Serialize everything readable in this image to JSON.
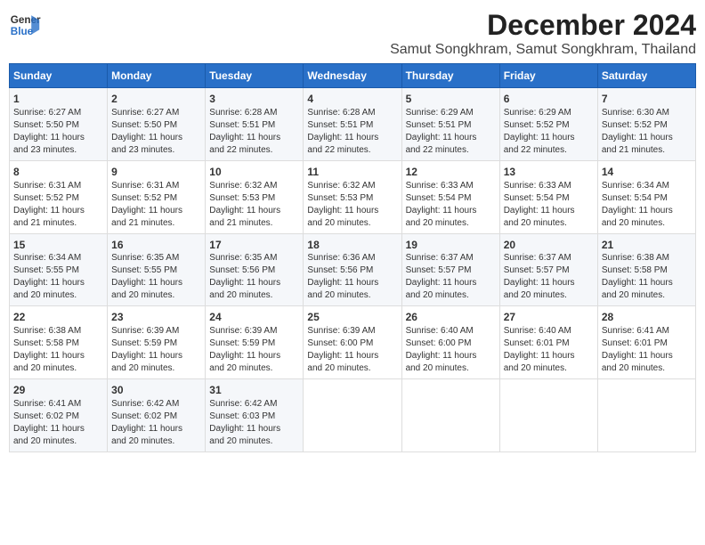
{
  "logo": {
    "line1": "General",
    "line2": "Blue"
  },
  "title": "December 2024",
  "subtitle": "Samut Songkhram, Samut Songkhram, Thailand",
  "days_header": [
    "Sunday",
    "Monday",
    "Tuesday",
    "Wednesday",
    "Thursday",
    "Friday",
    "Saturday"
  ],
  "weeks": [
    [
      {
        "day": "1",
        "info": "Sunrise: 6:27 AM\nSunset: 5:50 PM\nDaylight: 11 hours\nand 23 minutes."
      },
      {
        "day": "2",
        "info": "Sunrise: 6:27 AM\nSunset: 5:50 PM\nDaylight: 11 hours\nand 23 minutes."
      },
      {
        "day": "3",
        "info": "Sunrise: 6:28 AM\nSunset: 5:51 PM\nDaylight: 11 hours\nand 22 minutes."
      },
      {
        "day": "4",
        "info": "Sunrise: 6:28 AM\nSunset: 5:51 PM\nDaylight: 11 hours\nand 22 minutes."
      },
      {
        "day": "5",
        "info": "Sunrise: 6:29 AM\nSunset: 5:51 PM\nDaylight: 11 hours\nand 22 minutes."
      },
      {
        "day": "6",
        "info": "Sunrise: 6:29 AM\nSunset: 5:52 PM\nDaylight: 11 hours\nand 22 minutes."
      },
      {
        "day": "7",
        "info": "Sunrise: 6:30 AM\nSunset: 5:52 PM\nDaylight: 11 hours\nand 21 minutes."
      }
    ],
    [
      {
        "day": "8",
        "info": "Sunrise: 6:31 AM\nSunset: 5:52 PM\nDaylight: 11 hours\nand 21 minutes."
      },
      {
        "day": "9",
        "info": "Sunrise: 6:31 AM\nSunset: 5:52 PM\nDaylight: 11 hours\nand 21 minutes."
      },
      {
        "day": "10",
        "info": "Sunrise: 6:32 AM\nSunset: 5:53 PM\nDaylight: 11 hours\nand 21 minutes."
      },
      {
        "day": "11",
        "info": "Sunrise: 6:32 AM\nSunset: 5:53 PM\nDaylight: 11 hours\nand 20 minutes."
      },
      {
        "day": "12",
        "info": "Sunrise: 6:33 AM\nSunset: 5:54 PM\nDaylight: 11 hours\nand 20 minutes."
      },
      {
        "day": "13",
        "info": "Sunrise: 6:33 AM\nSunset: 5:54 PM\nDaylight: 11 hours\nand 20 minutes."
      },
      {
        "day": "14",
        "info": "Sunrise: 6:34 AM\nSunset: 5:54 PM\nDaylight: 11 hours\nand 20 minutes."
      }
    ],
    [
      {
        "day": "15",
        "info": "Sunrise: 6:34 AM\nSunset: 5:55 PM\nDaylight: 11 hours\nand 20 minutes."
      },
      {
        "day": "16",
        "info": "Sunrise: 6:35 AM\nSunset: 5:55 PM\nDaylight: 11 hours\nand 20 minutes."
      },
      {
        "day": "17",
        "info": "Sunrise: 6:35 AM\nSunset: 5:56 PM\nDaylight: 11 hours\nand 20 minutes."
      },
      {
        "day": "18",
        "info": "Sunrise: 6:36 AM\nSunset: 5:56 PM\nDaylight: 11 hours\nand 20 minutes."
      },
      {
        "day": "19",
        "info": "Sunrise: 6:37 AM\nSunset: 5:57 PM\nDaylight: 11 hours\nand 20 minutes."
      },
      {
        "day": "20",
        "info": "Sunrise: 6:37 AM\nSunset: 5:57 PM\nDaylight: 11 hours\nand 20 minutes."
      },
      {
        "day": "21",
        "info": "Sunrise: 6:38 AM\nSunset: 5:58 PM\nDaylight: 11 hours\nand 20 minutes."
      }
    ],
    [
      {
        "day": "22",
        "info": "Sunrise: 6:38 AM\nSunset: 5:58 PM\nDaylight: 11 hours\nand 20 minutes."
      },
      {
        "day": "23",
        "info": "Sunrise: 6:39 AM\nSunset: 5:59 PM\nDaylight: 11 hours\nand 20 minutes."
      },
      {
        "day": "24",
        "info": "Sunrise: 6:39 AM\nSunset: 5:59 PM\nDaylight: 11 hours\nand 20 minutes."
      },
      {
        "day": "25",
        "info": "Sunrise: 6:39 AM\nSunset: 6:00 PM\nDaylight: 11 hours\nand 20 minutes."
      },
      {
        "day": "26",
        "info": "Sunrise: 6:40 AM\nSunset: 6:00 PM\nDaylight: 11 hours\nand 20 minutes."
      },
      {
        "day": "27",
        "info": "Sunrise: 6:40 AM\nSunset: 6:01 PM\nDaylight: 11 hours\nand 20 minutes."
      },
      {
        "day": "28",
        "info": "Sunrise: 6:41 AM\nSunset: 6:01 PM\nDaylight: 11 hours\nand 20 minutes."
      }
    ],
    [
      {
        "day": "29",
        "info": "Sunrise: 6:41 AM\nSunset: 6:02 PM\nDaylight: 11 hours\nand 20 minutes."
      },
      {
        "day": "30",
        "info": "Sunrise: 6:42 AM\nSunset: 6:02 PM\nDaylight: 11 hours\nand 20 minutes."
      },
      {
        "day": "31",
        "info": "Sunrise: 6:42 AM\nSunset: 6:03 PM\nDaylight: 11 hours\nand 20 minutes."
      },
      {
        "day": "",
        "info": ""
      },
      {
        "day": "",
        "info": ""
      },
      {
        "day": "",
        "info": ""
      },
      {
        "day": "",
        "info": ""
      }
    ]
  ]
}
